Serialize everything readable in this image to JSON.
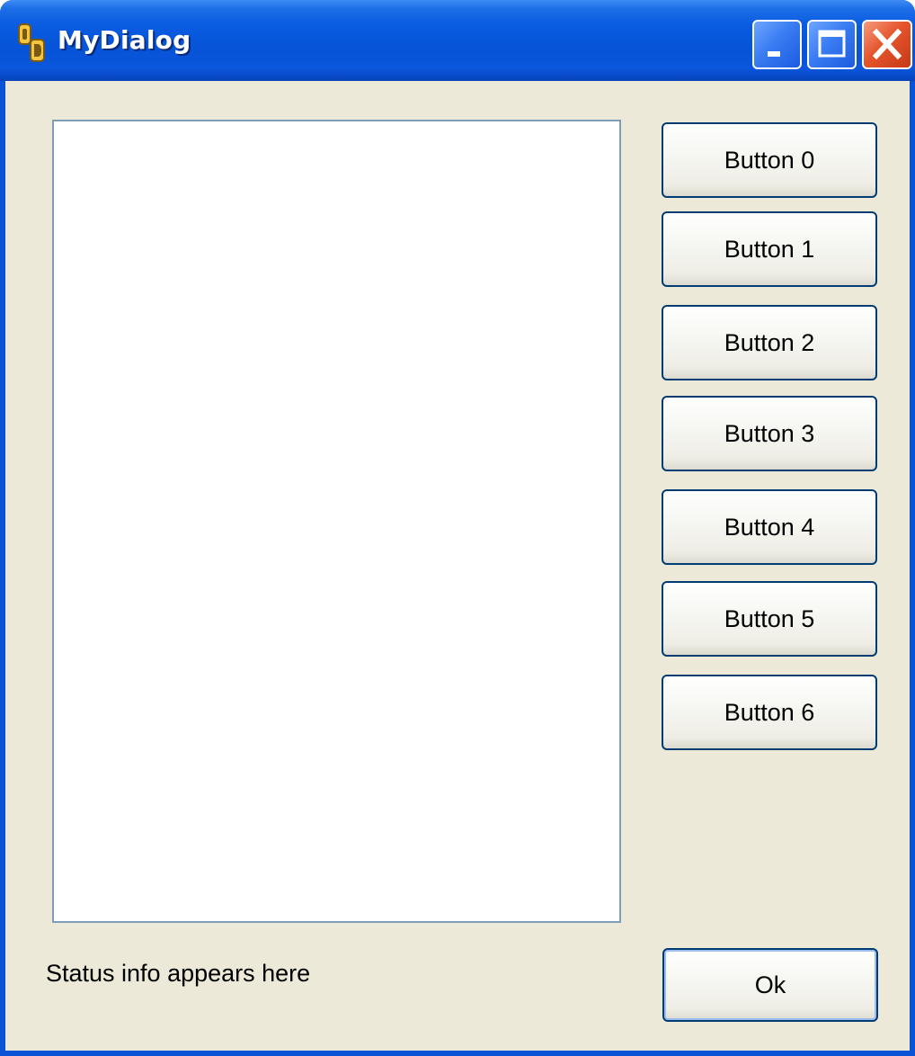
{
  "window": {
    "title": "MyDialog",
    "icon": "app-icon",
    "caption_buttons": [
      "minimize-icon",
      "maximize-icon",
      "close-icon"
    ]
  },
  "buttons": [
    {
      "label": "Button 0"
    },
    {
      "label": "Button 1"
    },
    {
      "label": "Button 2"
    },
    {
      "label": "Button 3"
    },
    {
      "label": "Button 4"
    },
    {
      "label": "Button 5"
    },
    {
      "label": "Button 6"
    }
  ],
  "ok_button": {
    "label": "Ok"
  },
  "status": {
    "text": "Status info appears here"
  },
  "colors": {
    "titlebar": "#0a56dc",
    "client_background": "#ece9d8",
    "button_border": "#003c74",
    "close_button": "#e5552c",
    "listbox_border": "#7f9db9"
  }
}
